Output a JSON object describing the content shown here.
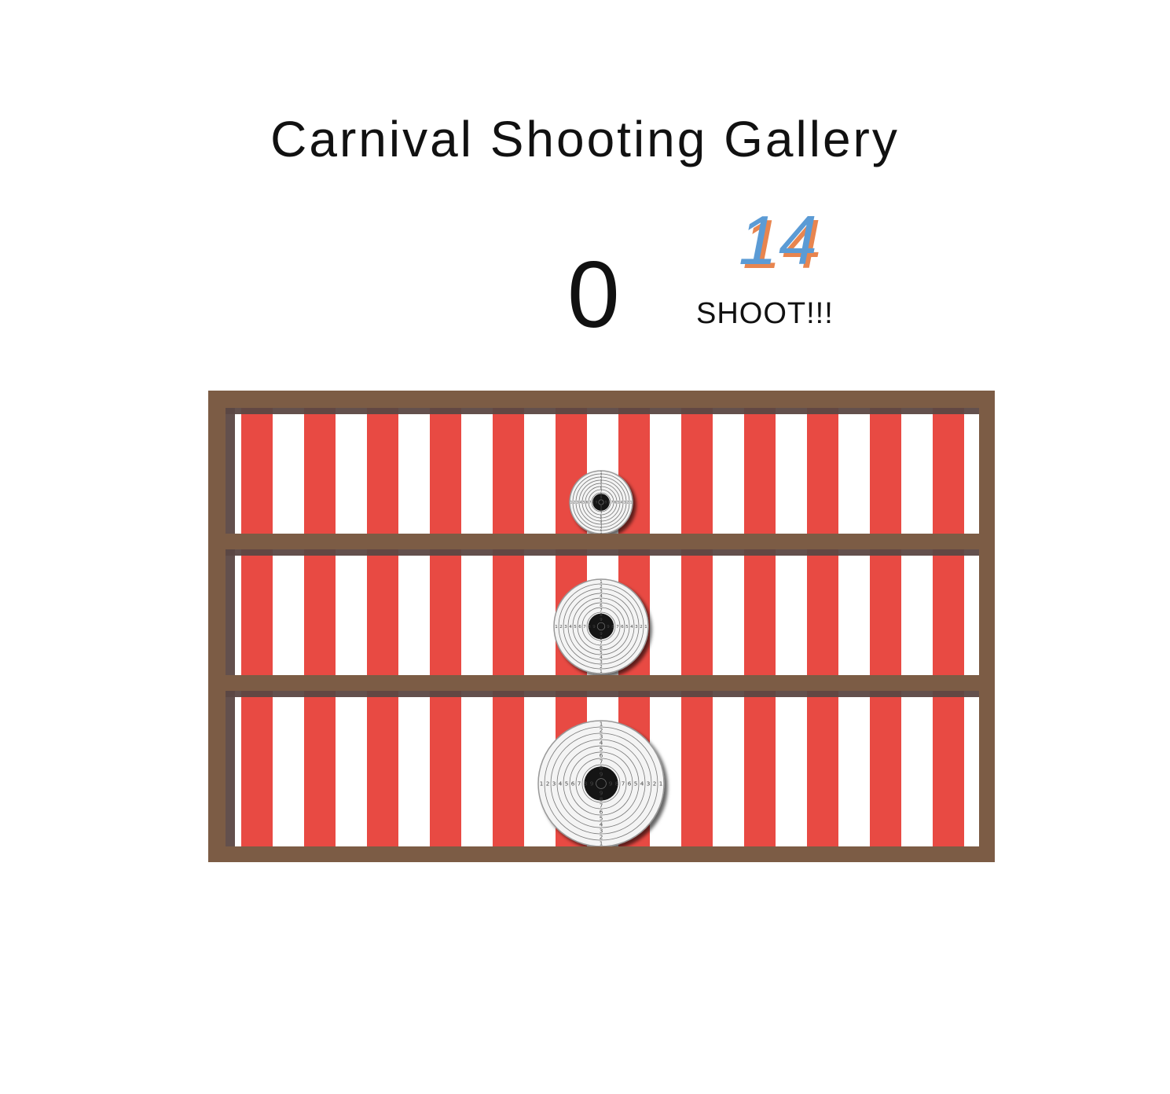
{
  "title": "Carnival Shooting Gallery",
  "score": "0",
  "timer": "14",
  "status": "SHOOT!!!",
  "colors": {
    "stripe_red": "#e84a43",
    "stripe_white": "#ffffff",
    "frame_brown": "#7c5c45",
    "frame_shadow": "#5b4743",
    "timer_blue": "#5b9bd5",
    "timer_shadow": "#e8854f"
  },
  "targets": [
    {
      "shelf": 1,
      "size": "small",
      "rings": [
        "1",
        "2",
        "3",
        "4",
        "5",
        "6",
        "7",
        "8",
        "9"
      ]
    },
    {
      "shelf": 2,
      "size": "medium",
      "rings": [
        "1",
        "2",
        "3",
        "4",
        "5",
        "6",
        "7",
        "8",
        "9"
      ]
    },
    {
      "shelf": 3,
      "size": "large",
      "rings": [
        "1",
        "2",
        "3",
        "4",
        "5",
        "6",
        "7",
        "8",
        "9"
      ]
    }
  ]
}
